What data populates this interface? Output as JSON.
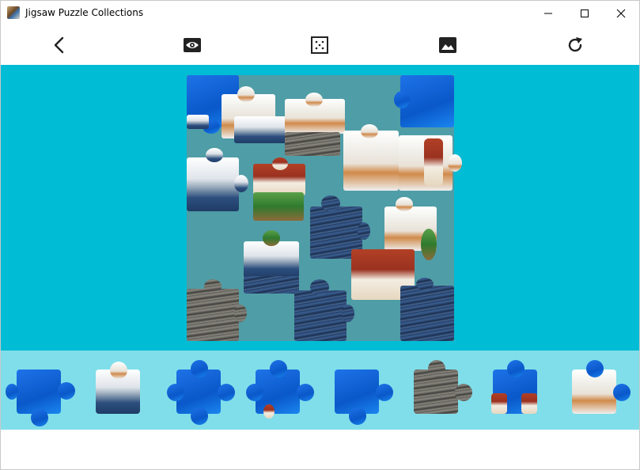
{
  "window": {
    "title": "Jigsaw Puzzle Collections",
    "minimize_label": "—",
    "maximize_label": "☐",
    "close_label": "✕"
  },
  "toolbar": {
    "icons": [
      "chevron-left-icon",
      "eye-icon",
      "grid-dots-icon",
      "image-icon",
      "refresh-icon"
    ]
  },
  "colors": {
    "board_area": "#00bcd4",
    "board": "#4f9da6",
    "tray": "#80deea",
    "sky_piece": "#1a86f0"
  },
  "tray": {
    "piece_count_visible": 8
  }
}
